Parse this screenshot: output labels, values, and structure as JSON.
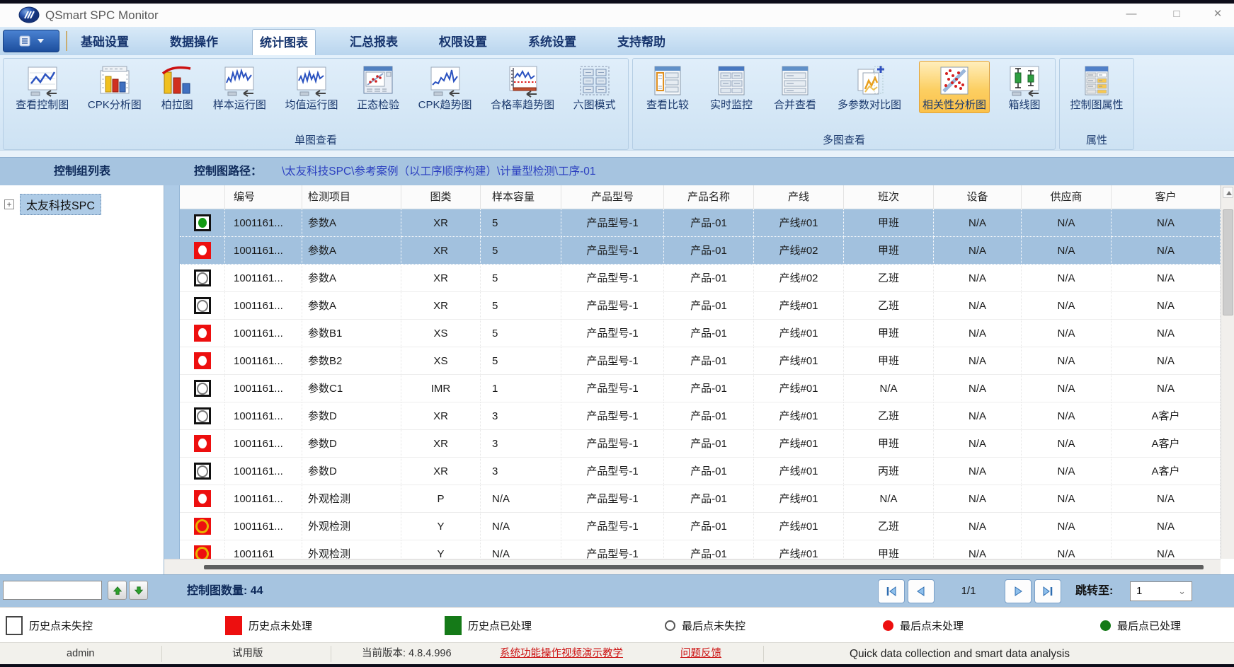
{
  "window": {
    "title": "QSmart SPC Monitor",
    "minimize": "—",
    "maximize": "□",
    "close": "✕"
  },
  "menu": {
    "tabs": [
      "基础设置",
      "数据操作",
      "统计图表",
      "汇总报表",
      "权限设置",
      "系统设置",
      "支持帮助"
    ],
    "active_tab": "统计图表"
  },
  "ribbon": {
    "groups": [
      {
        "label": "单图查看",
        "buttons": [
          {
            "label": "查看控制图"
          },
          {
            "label": "CPK分析图"
          },
          {
            "label": "柏拉图"
          },
          {
            "label": "样本运行图"
          },
          {
            "label": "均值运行图"
          },
          {
            "label": "正态检验"
          },
          {
            "label": "CPK趋势图"
          },
          {
            "label": "合格率趋势图"
          },
          {
            "label": "六图模式"
          }
        ]
      },
      {
        "label": "多图查看",
        "buttons": [
          {
            "label": "查看比较"
          },
          {
            "label": "实时监控"
          },
          {
            "label": "合并查看"
          },
          {
            "label": "多参数对比图"
          },
          {
            "label": "相关性分析图",
            "active": true
          },
          {
            "label": "箱线图"
          }
        ]
      },
      {
        "label": "属性",
        "buttons": [
          {
            "label": "控制图属性"
          }
        ]
      }
    ]
  },
  "pathbar": {
    "panel_title": "控制组列表",
    "path_label": "控制图路径：",
    "path_value": "\\太友科技SPC\\参考案例（以工序顺序构建）\\计量型检测\\工序-01"
  },
  "sidebar": {
    "root_node": "太友科技SPC",
    "expand_glyph": "+",
    "search_value": ""
  },
  "table": {
    "columns": [
      "",
      "编号",
      "检测项目",
      "图类",
      "样本容量",
      "产品型号",
      "产品名称",
      "产线",
      "班次",
      "设备",
      "供应商",
      "客户"
    ],
    "rows": [
      {
        "status": "green-dot",
        "selected": true,
        "cells": [
          "1001161...",
          "参数A",
          "XR",
          "5",
          "产品型号-1",
          "产品-01",
          "产线#01",
          "甲班",
          "N/A",
          "N/A",
          "N/A"
        ]
      },
      {
        "status": "red-dot",
        "selected": true,
        "cells": [
          "1001161...",
          "参数A",
          "XR",
          "5",
          "产品型号-1",
          "产品-01",
          "产线#02",
          "甲班",
          "N/A",
          "N/A",
          "N/A"
        ]
      },
      {
        "status": "ring",
        "selected": false,
        "cells": [
          "1001161...",
          "参数A",
          "XR",
          "5",
          "产品型号-1",
          "产品-01",
          "产线#02",
          "乙班",
          "N/A",
          "N/A",
          "N/A"
        ]
      },
      {
        "status": "ring",
        "selected": false,
        "cells": [
          "1001161...",
          "参数A",
          "XR",
          "5",
          "产品型号-1",
          "产品-01",
          "产线#01",
          "乙班",
          "N/A",
          "N/A",
          "N/A"
        ]
      },
      {
        "status": "red-dot",
        "selected": false,
        "cells": [
          "1001161...",
          "参数B1",
          "XS",
          "5",
          "产品型号-1",
          "产品-01",
          "产线#01",
          "甲班",
          "N/A",
          "N/A",
          "N/A"
        ]
      },
      {
        "status": "red-dot",
        "selected": false,
        "cells": [
          "1001161...",
          "参数B2",
          "XS",
          "5",
          "产品型号-1",
          "产品-01",
          "产线#01",
          "甲班",
          "N/A",
          "N/A",
          "N/A"
        ]
      },
      {
        "status": "ring",
        "selected": false,
        "cells": [
          "1001161...",
          "参数C1",
          "IMR",
          "1",
          "产品型号-1",
          "产品-01",
          "产线#01",
          "N/A",
          "N/A",
          "N/A",
          "N/A"
        ]
      },
      {
        "status": "ring",
        "selected": false,
        "cells": [
          "1001161...",
          "参数D",
          "XR",
          "3",
          "产品型号-1",
          "产品-01",
          "产线#01",
          "乙班",
          "N/A",
          "N/A",
          "A客户"
        ]
      },
      {
        "status": "red-dot",
        "selected": false,
        "cells": [
          "1001161...",
          "参数D",
          "XR",
          "3",
          "产品型号-1",
          "产品-01",
          "产线#01",
          "甲班",
          "N/A",
          "N/A",
          "A客户"
        ]
      },
      {
        "status": "ring",
        "selected": false,
        "cells": [
          "1001161...",
          "参数D",
          "XR",
          "3",
          "产品型号-1",
          "产品-01",
          "产线#01",
          "丙班",
          "N/A",
          "N/A",
          "A客户"
        ]
      },
      {
        "status": "red-dot",
        "selected": false,
        "cells": [
          "1001161...",
          "外观检测",
          "P",
          "N/A",
          "产品型号-1",
          "产品-01",
          "产线#01",
          "N/A",
          "N/A",
          "N/A",
          "N/A"
        ]
      },
      {
        "status": "red-ring",
        "selected": false,
        "cells": [
          "1001161...",
          "外观检测",
          "Y",
          "N/A",
          "产品型号-1",
          "产品-01",
          "产线#01",
          "乙班",
          "N/A",
          "N/A",
          "N/A"
        ]
      },
      {
        "status": "red-ring",
        "selected": false,
        "cells": [
          "1001161",
          "外观检测",
          "Y",
          "N/A",
          "产品型号-1",
          "产品-01",
          "产线#01",
          "甲班",
          "N/A",
          "N/A",
          "N/A"
        ]
      }
    ]
  },
  "footer": {
    "count_label": "控制图数量: 44",
    "page_indicator": "1/1",
    "jump_label": "跳转至:",
    "jump_value": "1"
  },
  "legend": {
    "items": [
      {
        "shape": "square-outline",
        "label": "历史点未失控"
      },
      {
        "shape": "square-red",
        "label": "历史点未处理"
      },
      {
        "shape": "square-green",
        "label": "历史点已处理"
      },
      {
        "shape": "circle-outline",
        "label": "最后点未失控"
      },
      {
        "shape": "circle-red",
        "label": "最后点未处理"
      },
      {
        "shape": "circle-green",
        "label": "最后点已处理"
      }
    ]
  },
  "statusbar": {
    "user": "admin",
    "edition": "试用版",
    "version": "当前版本: 4.8.4.996",
    "video_link": "系统功能操作视频演示教学",
    "feedback_link": "问题反馈",
    "slogan": "Quick data collection and smart data analysis"
  },
  "colors": {
    "bar_blue": "#a6c4e0",
    "selected_row": "#a2c1de",
    "alert_red": "#ed0f0f",
    "ok_green": "#157a18",
    "highlight_orange": "#fbc14a",
    "link_red": "#cc1111"
  }
}
